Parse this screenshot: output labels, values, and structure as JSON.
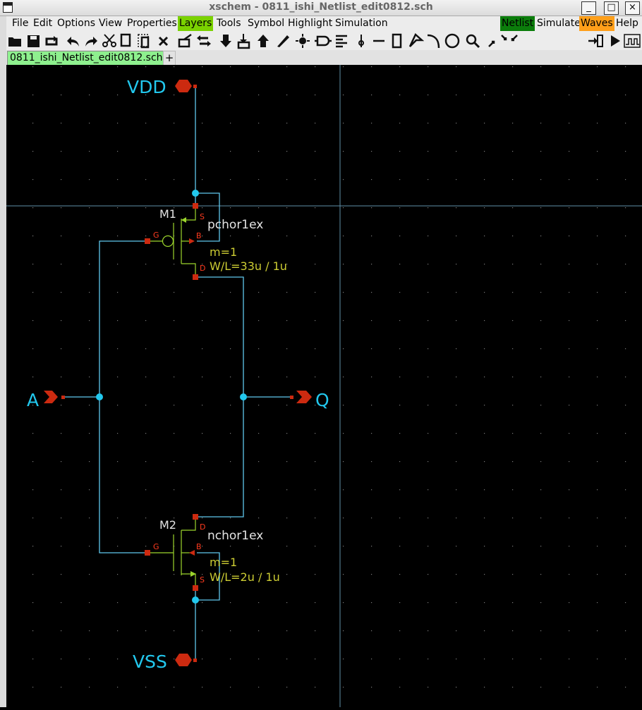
{
  "window": {
    "title": "xschem - 0811_ishi_Netlist_edit0812.sch",
    "minimize": "_",
    "maximize": "□",
    "close": "×"
  },
  "menu": {
    "file": "File",
    "edit": "Edit",
    "options": "Options",
    "view": "View",
    "properties": "Properties",
    "layers": "Layers",
    "tools": "Tools",
    "symbol": "Symbol",
    "highlight": "Highlight",
    "simulation": "Simulation",
    "netlist": "Netlist",
    "simulate": "Simulate",
    "waves": "Waves",
    "help": "Help"
  },
  "colors": {
    "layers_bg": "#7ad200",
    "netlist_bg": "#0b7d0b",
    "waves_bg": "#ff9f1a",
    "tab_active": "#8ef08e",
    "wire": "#5fc8ee",
    "pin": "#cc2a10",
    "label_green": "#cccc33",
    "device_green": "#9cd52c",
    "grid": "#7a7a7a"
  },
  "toolbar": {
    "icons": [
      "open-icon",
      "save-icon",
      "reload-icon",
      "undo-icon",
      "redo-icon",
      "cut-icon",
      "copy-icon",
      "paste-icon",
      "delete-icon",
      "move-icon",
      "swap-icon",
      "push-down-icon",
      "make-symbol-icon",
      "pop-up-icon",
      "pencil-icon",
      "highlight-icon",
      "insert-symbol-icon",
      "align-icon",
      "probe-pin-icon",
      "line-icon",
      "rectangle-icon",
      "polygon-icon",
      "arc-icon",
      "circle-icon",
      "zoom-icon",
      "zoom-fit-icon",
      "netlist-push-icon",
      "run-icon",
      "waveform-icon"
    ]
  },
  "tabs": {
    "active": "0811_ishi_Netlist_edit0812.sch",
    "add": "+"
  },
  "schematic": {
    "pins": {
      "vdd": "VDD",
      "vss": "VSS",
      "a": "A",
      "q": "Q"
    },
    "m1": {
      "ref": "M1",
      "model": "pchor1ex",
      "mult": "m=1",
      "wl": "W/L=33u / 1u",
      "pin_s": "S",
      "pin_g": "G",
      "pin_b": "B",
      "pin_d": "D"
    },
    "m2": {
      "ref": "M2",
      "model": "nchor1ex",
      "mult": "m=1",
      "wl": "W/L=2u / 1u",
      "pin_d": "D",
      "pin_g": "G",
      "pin_b": "B",
      "pin_s": "S"
    }
  }
}
